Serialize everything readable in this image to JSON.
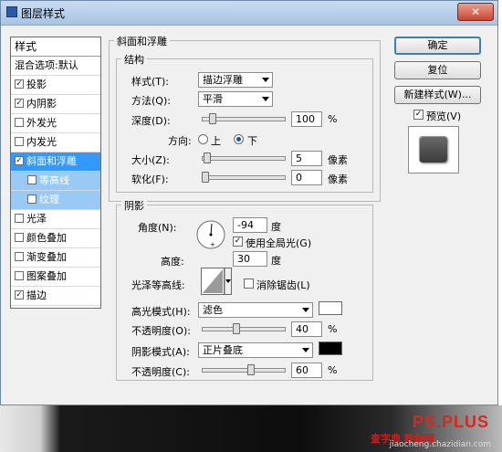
{
  "window": {
    "title": "图层样式",
    "close_glyph": "✕"
  },
  "styles_panel": {
    "header": "样式",
    "items": [
      {
        "label": "混合选项:默认",
        "checkbox": false,
        "checked": false
      },
      {
        "label": "投影",
        "checkbox": true,
        "checked": true
      },
      {
        "label": "内阴影",
        "checkbox": true,
        "checked": true
      },
      {
        "label": "外发光",
        "checkbox": true,
        "checked": false
      },
      {
        "label": "内发光",
        "checkbox": true,
        "checked": false
      },
      {
        "label": "斜面和浮雕",
        "checkbox": true,
        "checked": true,
        "selected": true
      },
      {
        "label": "等高线",
        "checkbox": true,
        "checked": false,
        "sub": true
      },
      {
        "label": "纹理",
        "checkbox": true,
        "checked": false,
        "sub": true
      },
      {
        "label": "光泽",
        "checkbox": true,
        "checked": false
      },
      {
        "label": "颜色叠加",
        "checkbox": true,
        "checked": false
      },
      {
        "label": "渐变叠加",
        "checkbox": true,
        "checked": false
      },
      {
        "label": "图案叠加",
        "checkbox": true,
        "checked": false
      },
      {
        "label": "描边",
        "checkbox": true,
        "checked": true
      }
    ]
  },
  "bevel": {
    "section_title": "斜面和浮雕",
    "structure_title": "结构",
    "style_label": "样式(T):",
    "style_value": "描边浮雕",
    "technique_label": "方法(Q):",
    "technique_value": "平滑",
    "depth_label": "深度(D):",
    "depth_value": "100",
    "depth_unit": "%",
    "depth_level": 0.1,
    "direction_label": "方向:",
    "direction_up": "上",
    "direction_down": "下",
    "size_label": "大小(Z):",
    "size_value": "5",
    "size_unit": "像素",
    "size_level": 0.02,
    "soften_label": "软化(F):",
    "soften_value": "0",
    "soften_unit": "像素",
    "soften_level": 0.0
  },
  "shading": {
    "title": "阴影",
    "angle_label": "角度(N):",
    "angle_value": "-94",
    "angle_unit": "度",
    "global_light_label": "使用全局光(G)",
    "altitude_label": "高度:",
    "altitude_value": "30",
    "altitude_unit": "度",
    "gloss_label": "光泽等高线:",
    "anti_alias_label": "消除锯齿(L)",
    "highlight_mode_label": "高光模式(H):",
    "highlight_mode_value": "滤色",
    "highlight_color": "#ffffff",
    "highlight_opacity_label": "不透明度(O):",
    "highlight_opacity_value": "40",
    "highlight_opacity_unit": "%",
    "highlight_opacity_level": 0.4,
    "shadow_mode_label": "阴影模式(A):",
    "shadow_mode_value": "正片叠底",
    "shadow_color": "#000000",
    "shadow_opacity_label": "不透明度(C):",
    "shadow_opacity_value": "60",
    "shadow_opacity_unit": "%",
    "shadow_opacity_level": 0.6
  },
  "buttons": {
    "ok": "确定",
    "reset": "复位",
    "new_style": "新建样式(W)...",
    "preview_label": "预览(V)"
  },
  "watermark": {
    "brand": "PS.PLUS",
    "cn_text": "查字典 教程网",
    "url": "jiaocheng.chazidian.com"
  }
}
